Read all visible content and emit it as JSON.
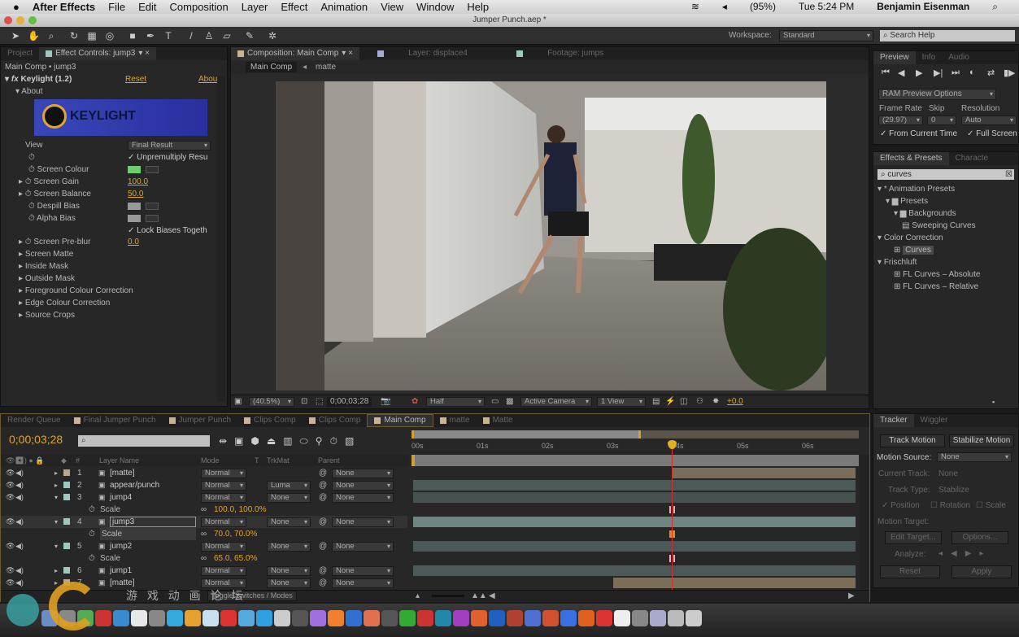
{
  "menubar": {
    "app": "After Effects",
    "items": [
      "File",
      "Edit",
      "Composition",
      "Layer",
      "Effect",
      "Animation",
      "View",
      "Window",
      "Help"
    ],
    "battery": "(95%)",
    "clock": "Tue 5:24 PM",
    "user": "Benjamin Eisenman"
  },
  "window": {
    "title": "Jumper Punch.aep *"
  },
  "toolbar": {
    "workspace_label": "Workspace:",
    "workspace_value": "Standard",
    "search_placeholder": "Search Help"
  },
  "effect_controls": {
    "tab_project": "Project",
    "tab_label": "Effect Controls: jump3",
    "breadcrumb": "Main Comp • jump3",
    "effect_name": "Keylight (1.2)",
    "reset": "Reset",
    "about": "Abou",
    "about_group": "About",
    "logo_text": "KEYLIGHT",
    "view_label": "View",
    "view_value": "Final Result",
    "unpremultiply": "Unpremultiply Resu",
    "screen_colour": "Screen Colour",
    "screen_colour_hex": "#6ccf6c",
    "screen_gain": "Screen Gain",
    "screen_gain_value": "100.0",
    "screen_balance": "Screen Balance",
    "screen_balance_value": "50.0",
    "despill_bias": "Despill Bias",
    "alpha_bias": "Alpha Bias",
    "lock_biases": "Lock Biases Togeth",
    "screen_preblur": "Screen Pre-blur",
    "screen_preblur_value": "0.0",
    "groups": [
      "Screen Matte",
      "Inside Mask",
      "Outside Mask",
      "Foreground Colour Correction",
      "Edge Colour Correction",
      "Source Crops"
    ]
  },
  "composition": {
    "tab_label": "Composition: Main Comp",
    "tab_layer": "Layer: displace4",
    "tab_footage": "Footage: jumps",
    "crumb_main": "Main Comp",
    "crumb_matte": "matte",
    "zoom": "(40.5%)",
    "timecode": "0;00;03;28",
    "resolution": "Half",
    "camera": "Active Camera",
    "views": "1 View",
    "exposure": "+0.0"
  },
  "preview": {
    "tabs": [
      "Preview",
      "Info",
      "Audio"
    ],
    "ram_options": "RAM Preview Options",
    "frame_rate_label": "Frame Rate",
    "frame_rate": "(29.97)",
    "skip_label": "Skip",
    "skip": "0",
    "resolution_label": "Resolution",
    "resolution": "Auto",
    "from_current": "From Current Time",
    "full_screen": "Full Screen"
  },
  "effects_presets": {
    "tab": "Effects & Presets",
    "tab2": "Characte",
    "search": "curves",
    "tree": [
      {
        "label": "* Animation Presets",
        "indent": 0,
        "type": "open"
      },
      {
        "label": "Presets",
        "indent": 1,
        "type": "folder"
      },
      {
        "label": "Backgrounds",
        "indent": 2,
        "type": "folder"
      },
      {
        "label": "Sweeping Curves",
        "indent": 3,
        "type": "preset"
      },
      {
        "label": "Color Correction",
        "indent": 0,
        "type": "open"
      },
      {
        "label": "Curves",
        "indent": 2,
        "type": "effect",
        "selected": true
      },
      {
        "label": "Frischluft",
        "indent": 0,
        "type": "open"
      },
      {
        "label": "FL Curves – Absolute",
        "indent": 2,
        "type": "effect"
      },
      {
        "label": "FL Curves – Relative",
        "indent": 2,
        "type": "effect"
      }
    ]
  },
  "timeline": {
    "tabs": [
      "Render Queue",
      "Final Jumper Punch",
      "Jumper Punch",
      "Clips Comp",
      "Clips Comp",
      "Main Comp",
      "matte",
      "Matte"
    ],
    "active_tab": "Main Comp",
    "timecode": "0;00;03;28",
    "headers": {
      "num": "#",
      "name": "Layer Name",
      "mode": "Mode",
      "t": "T",
      "trkmat": "TrkMat",
      "parent": "Parent"
    },
    "ruler": [
      "00s",
      "01s",
      "02s",
      "03s",
      "04s",
      "05s",
      "06s"
    ],
    "layers": [
      {
        "num": "1",
        "name": "[matte]",
        "mode": "Normal",
        "trkmat": "",
        "parent": "None",
        "color": "#b8a888",
        "bar_start": 3.98,
        "bar_end": 6.8,
        "bar_color": "#7a6e58"
      },
      {
        "num": "2",
        "name": "appear/punch",
        "mode": "Normal",
        "trkmat": "Luma",
        "parent": "None",
        "color": "#9cc8c0",
        "bar_start": 0,
        "bar_end": 6.8,
        "bar_color": "#4b5a58"
      },
      {
        "num": "3",
        "name": "jump4",
        "mode": "Normal",
        "trkmat": "None",
        "parent": "None",
        "color": "#9cc8c0",
        "bar_start": 0,
        "bar_end": 6.8,
        "bar_color": "#46524f",
        "scale": "100.0, 100.0%"
      },
      {
        "num": "4",
        "name": "jump3",
        "mode": "Normal",
        "trkmat": "None",
        "parent": "None",
        "color": "#9cc8c0",
        "bar_start": 0,
        "bar_end": 6.8,
        "bar_color": "#6f8583",
        "scale": "70.0, 70.0%",
        "selected": true
      },
      {
        "num": "5",
        "name": "jump2",
        "mode": "Normal",
        "trkmat": "None",
        "parent": "None",
        "color": "#9cc8c0",
        "bar_start": 0,
        "bar_end": 6.8,
        "bar_color": "#4b5a58",
        "scale": "65.0, 65.0%"
      },
      {
        "num": "6",
        "name": "jump1",
        "mode": "Normal",
        "trkmat": "None",
        "parent": "None",
        "color": "#9cc8c0",
        "bar_start": 0,
        "bar_end": 6.8,
        "bar_color": "#4b5a58"
      },
      {
        "num": "7",
        "name": "[matte]",
        "mode": "Normal",
        "trkmat": "None",
        "parent": "None",
        "color": "#b8a888",
        "bar_start": 3.07,
        "bar_end": 6.8,
        "bar_color": "#7a6e58"
      }
    ],
    "scale_label": "Scale",
    "toggle": "Toggle Switches / Modes"
  },
  "tracker": {
    "tabs": [
      "Tracker",
      "Wiggler"
    ],
    "track_motion": "Track Motion",
    "stabilize_motion": "Stabilize Motion",
    "motion_source_label": "Motion Source:",
    "motion_source": "None",
    "current_track_label": "Current Track:",
    "current_track": "None",
    "track_type_label": "Track Type:",
    "track_type": "Stabilize",
    "position": "Position",
    "rotation": "Rotation",
    "scale": "Scale",
    "motion_target": "Motion Target:",
    "edit_target": "Edit Target...",
    "options": "Options...",
    "analyze": "Analyze:",
    "reset": "Reset",
    "apply": "Apply"
  },
  "watermark": {
    "text": "游 戏 动 画 论 坛",
    "logo": "CG JOY"
  },
  "colors": {
    "accent": "#e0a52a",
    "panel": "#272727",
    "playhead": "#d03030"
  }
}
